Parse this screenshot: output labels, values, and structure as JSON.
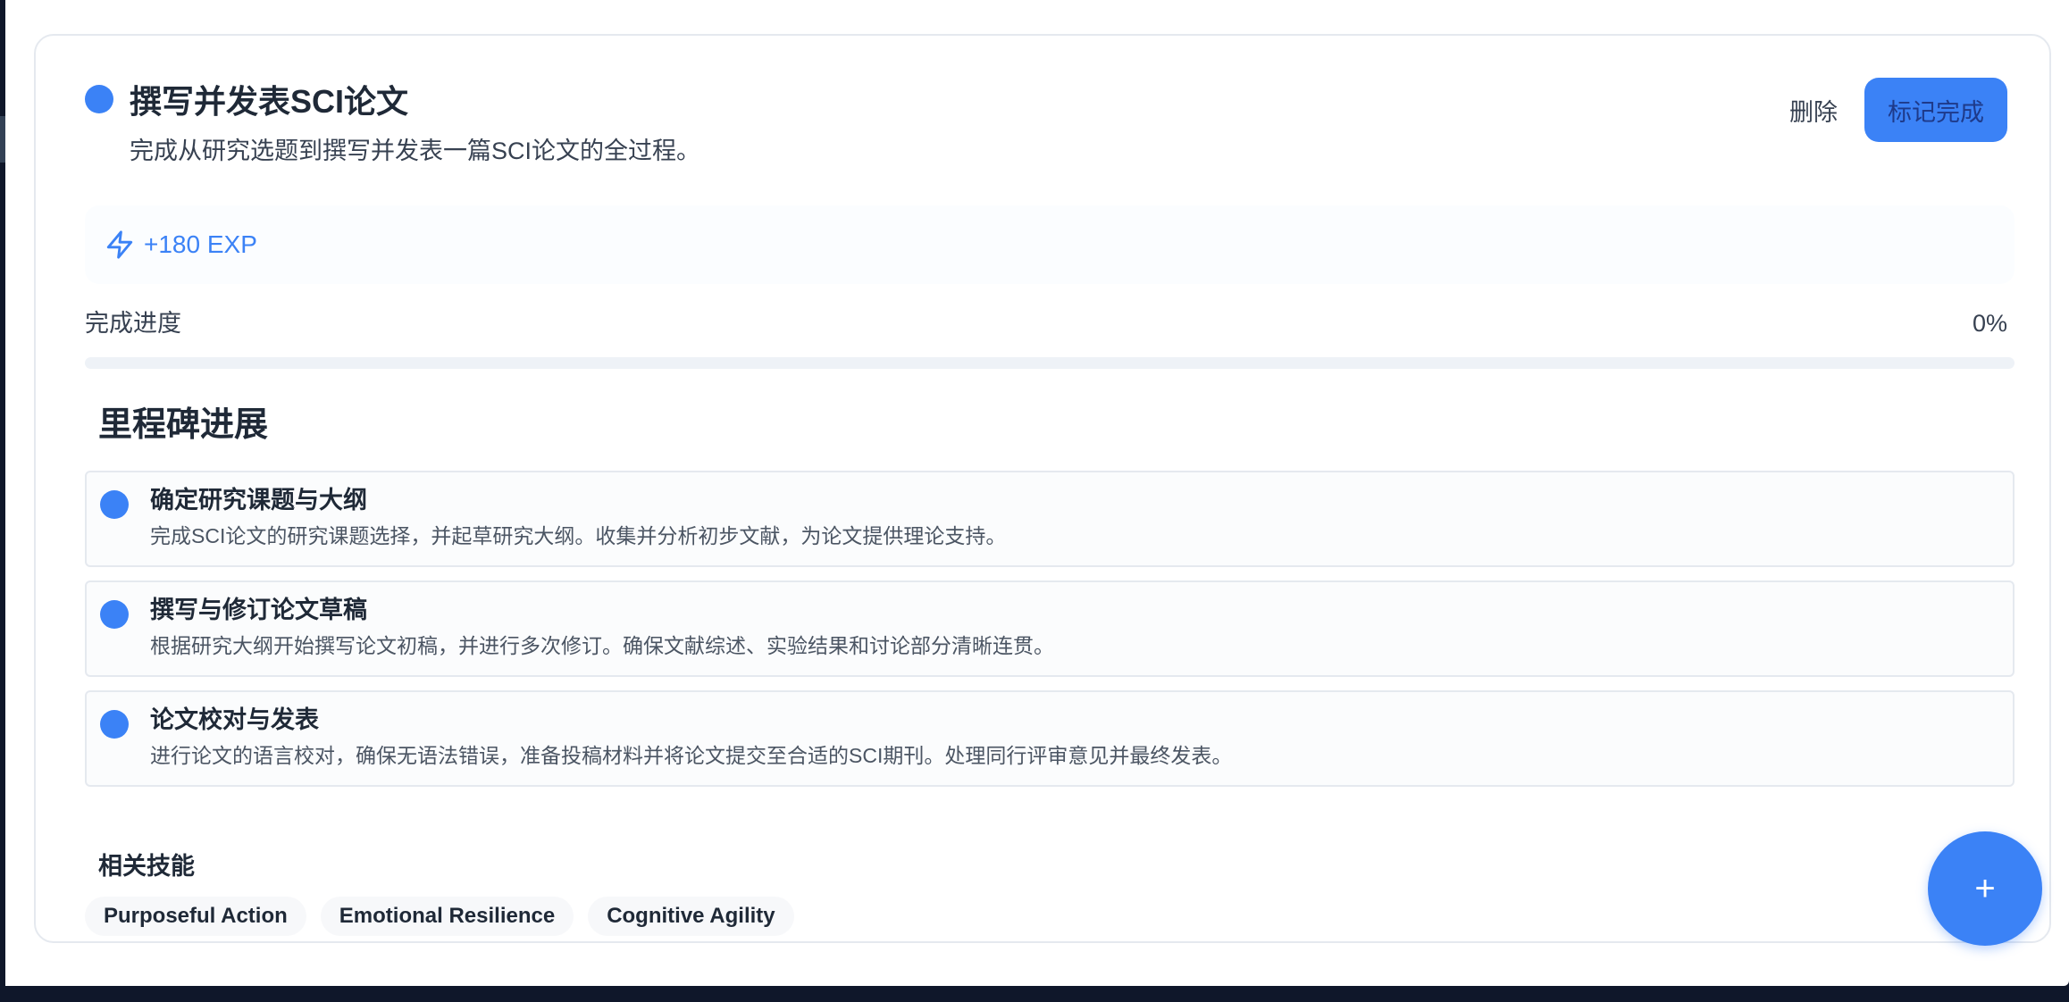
{
  "goal": {
    "title": "撰写并发表SCI论文",
    "description": "完成从研究选题到撰写并发表一篇SCI论文的全过程。",
    "status_color": "#3b82f6"
  },
  "actions": {
    "delete_label": "删除",
    "complete_label": "标记完成"
  },
  "exp": {
    "icon": "lightning-bolt-icon",
    "text": "+180 EXP"
  },
  "progress": {
    "label": "完成进度",
    "value_text": "0%",
    "fraction": 0
  },
  "milestones": {
    "title": "里程碑进展",
    "items": [
      {
        "title": "确定研究课题与大纲",
        "description": "完成SCI论文的研究课题选择，并起草研究大纲。收集并分析初步文献，为论文提供理论支持。"
      },
      {
        "title": "撰写与修订论文草稿",
        "description": "根据研究大纲开始撰写论文初稿，并进行多次修订。确保文献综述、实验结果和讨论部分清晰连贯。"
      },
      {
        "title": "论文校对与发表",
        "description": "进行论文的语言校对，确保无语法错误，准备投稿材料并将论文提交至合适的SCI期刊。处理同行评审意见并最终发表。"
      }
    ]
  },
  "skills": {
    "title": "相关技能",
    "items": [
      "Purposeful Action",
      "Emotional Resilience",
      "Cognitive Agility"
    ]
  },
  "fab": {
    "label": "+",
    "icon": "plus-icon"
  },
  "colors": {
    "accent": "#3b82f6",
    "background": "#0f172a",
    "card": "#ffffff"
  }
}
